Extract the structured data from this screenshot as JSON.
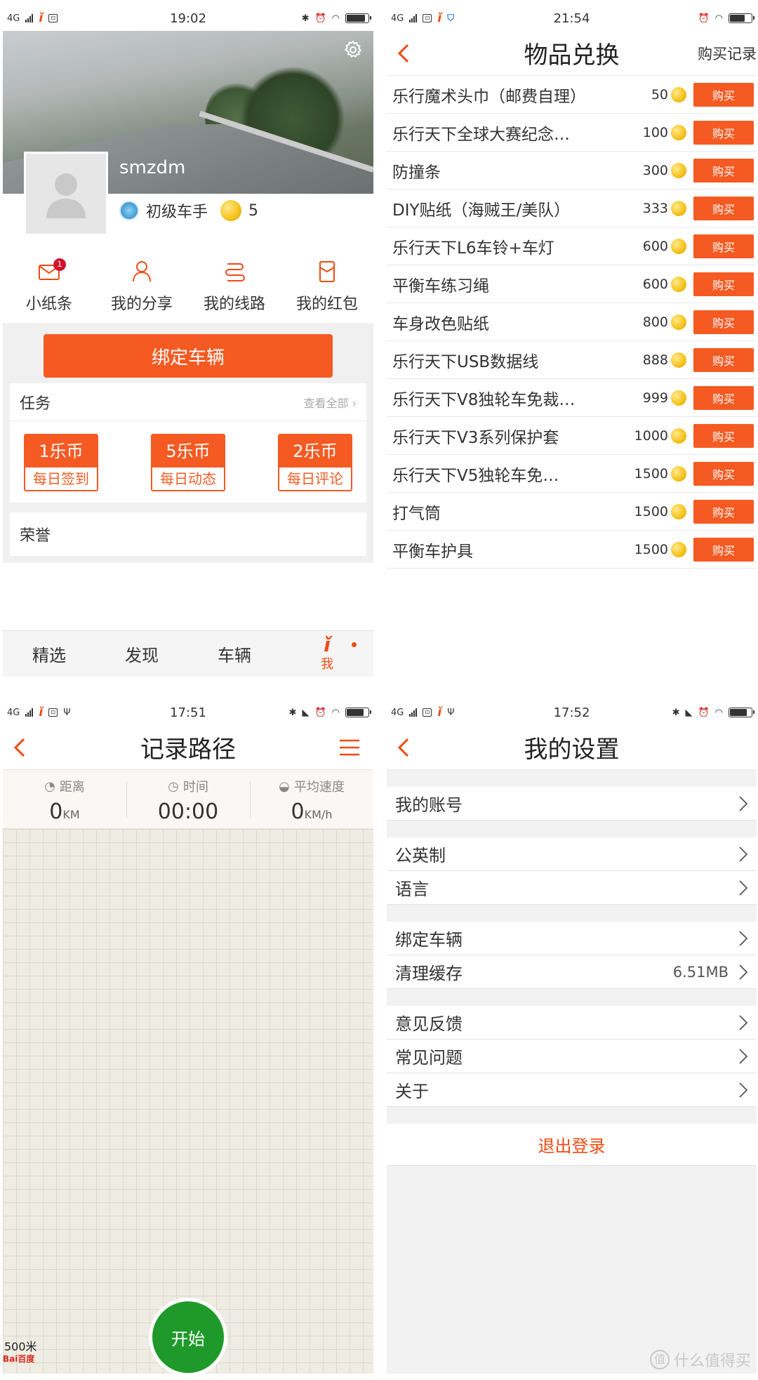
{
  "panel1": {
    "status": {
      "net": "4G",
      "time": "19:02"
    },
    "username": "smzdm",
    "level": "初级车手",
    "coins": "5",
    "quick": [
      {
        "label": "小纸条",
        "badge": "1"
      },
      {
        "label": "我的分享"
      },
      {
        "label": "我的线路"
      },
      {
        "label": "我的红包"
      }
    ],
    "bind_button": "绑定车辆",
    "tasks_title": "任务",
    "view_all": "查看全部",
    "tasks": [
      {
        "reward": "1乐币",
        "name": "每日签到"
      },
      {
        "reward": "5乐币",
        "name": "每日动态"
      },
      {
        "reward": "2乐币",
        "name": "每日评论"
      }
    ],
    "honor_title": "荣誉",
    "tabs": [
      "精选",
      "发现",
      "车辆",
      "我"
    ]
  },
  "panel2": {
    "status": {
      "net": "4G",
      "time": "21:54"
    },
    "title": "物品兑换",
    "right": "购买记录",
    "buy_label": "购买",
    "items": [
      {
        "name": "乐行魔术头巾（邮费自理）",
        "price": "50"
      },
      {
        "name": "乐行天下全球大赛纪念…",
        "price": "100"
      },
      {
        "name": "防撞条",
        "price": "300"
      },
      {
        "name": "DIY贴纸（海贼王/美队）",
        "price": "333"
      },
      {
        "name": "乐行天下L6车铃+车灯",
        "price": "600"
      },
      {
        "name": "平衡车练习绳",
        "price": "600"
      },
      {
        "name": "车身改色贴纸",
        "price": "800"
      },
      {
        "name": "乐行天下USB数据线",
        "price": "888"
      },
      {
        "name": "乐行天下V8独轮车免裁…",
        "price": "999"
      },
      {
        "name": "乐行天下V3系列保护套",
        "price": "1000"
      },
      {
        "name": "乐行天下V5独轮车免…",
        "price": "1500"
      },
      {
        "name": "打气筒",
        "price": "1500"
      },
      {
        "name": "平衡车护具",
        "price": "1500"
      }
    ]
  },
  "panel3": {
    "status": {
      "net": "4G",
      "time": "17:51"
    },
    "title": "记录路径",
    "stats": [
      {
        "label": "距离",
        "value": "0",
        "unit": "KM"
      },
      {
        "label": "时间",
        "value": "00:00",
        "unit": ""
      },
      {
        "label": "平均速度",
        "value": "0",
        "unit": "KM/h"
      }
    ],
    "start": "开始",
    "scale": "500米",
    "map_brand": "Bai百度"
  },
  "panel4": {
    "status": {
      "net": "4G",
      "time": "17:52"
    },
    "title": "我的设置",
    "groups": [
      [
        {
          "label": "我的账号"
        }
      ],
      [
        {
          "label": "公英制"
        },
        {
          "label": "语言"
        }
      ],
      [
        {
          "label": "绑定车辆"
        },
        {
          "label": "清理缓存",
          "value": "6.51MB"
        }
      ],
      [
        {
          "label": "意见反馈"
        },
        {
          "label": "常见问题"
        },
        {
          "label": "关于"
        }
      ]
    ],
    "logout": "退出登录",
    "watermark": "什么值得买"
  },
  "colors": {
    "accent": "#f55a22",
    "brand": "#f04a12",
    "start_green": "#1f9a2a"
  }
}
